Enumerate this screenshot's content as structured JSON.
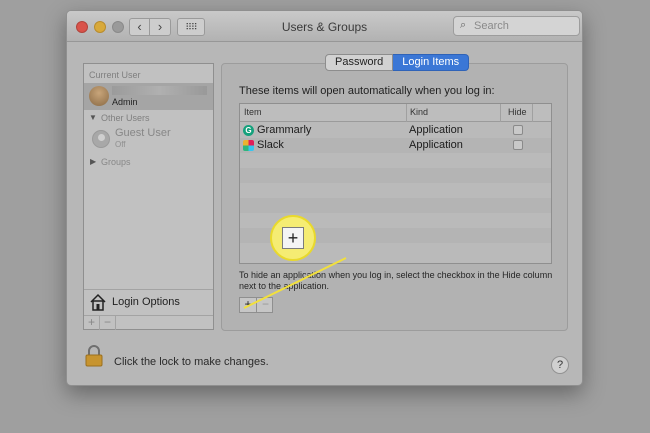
{
  "window": {
    "title": "Users & Groups",
    "nav_back": "‹",
    "nav_forward": "›",
    "grid_icon": "⠿⠿",
    "search_placeholder": "Search"
  },
  "sidebar": {
    "current_user_header": "Current User",
    "current_user_role": "Admin",
    "other_users_header": "Other Users",
    "guest_name": "Guest User",
    "guest_status": "Off",
    "groups_label": "Groups",
    "login_options_label": "Login Options",
    "add_label": "+",
    "remove_label": "−"
  },
  "tabs": [
    {
      "label": "Password",
      "selected": false
    },
    {
      "label": "Login Items",
      "selected": true
    }
  ],
  "panel": {
    "description": "These items will open automatically when you log in:",
    "columns": [
      "Item",
      "Kind",
      "Hide"
    ],
    "rows": [
      {
        "name": "Grammarly",
        "kind": "Application",
        "hide": false,
        "icon": "grammarly-icon"
      },
      {
        "name": "Slack",
        "kind": "Application",
        "hide": false,
        "icon": "slack-icon"
      }
    ],
    "help_text": "To hide an application when you log in, select the checkbox in the Hide column next to the application.",
    "add_label": "+",
    "remove_label": "−"
  },
  "footer": {
    "lock_text": "Click the lock to make changes.",
    "help_label": "?"
  },
  "callout": {
    "label": "+",
    "color": "#f5ec73"
  }
}
